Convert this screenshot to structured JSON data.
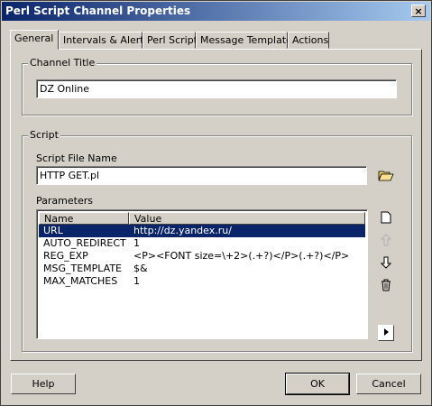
{
  "window": {
    "title": "Perl Script Channel Properties",
    "close_glyph": "×"
  },
  "tabs": [
    "General",
    "Intervals & Alerts",
    "Perl Script",
    "Message Template",
    "Actions"
  ],
  "channel_title": {
    "label": "Channel Title",
    "value": "DZ Online"
  },
  "script": {
    "group_label": "Script",
    "file_label": "Script File Name",
    "file_value": "HTTP GET.pl",
    "params_label": "Parameters",
    "columns": [
      "Name",
      "Value"
    ],
    "rows": [
      {
        "name": "URL",
        "value": "http://dz.yandex.ru/"
      },
      {
        "name": "AUTO_REDIRECT",
        "value": "1"
      },
      {
        "name": "REG_EXP",
        "value": "<P><FONT size=\\+2>(.+?)</P>(.+?)</P>"
      },
      {
        "name": "MSG_TEMPLATE",
        "value": "$&"
      },
      {
        "name": "MAX_MATCHES",
        "value": "1"
      }
    ],
    "selected_row": 0
  },
  "icons": [
    "folder-open-icon",
    "new-item-icon",
    "move-up-icon",
    "move-down-icon",
    "delete-icon",
    "expand-icon"
  ],
  "buttons": {
    "help": "Help",
    "ok": "OK",
    "cancel": "Cancel"
  }
}
